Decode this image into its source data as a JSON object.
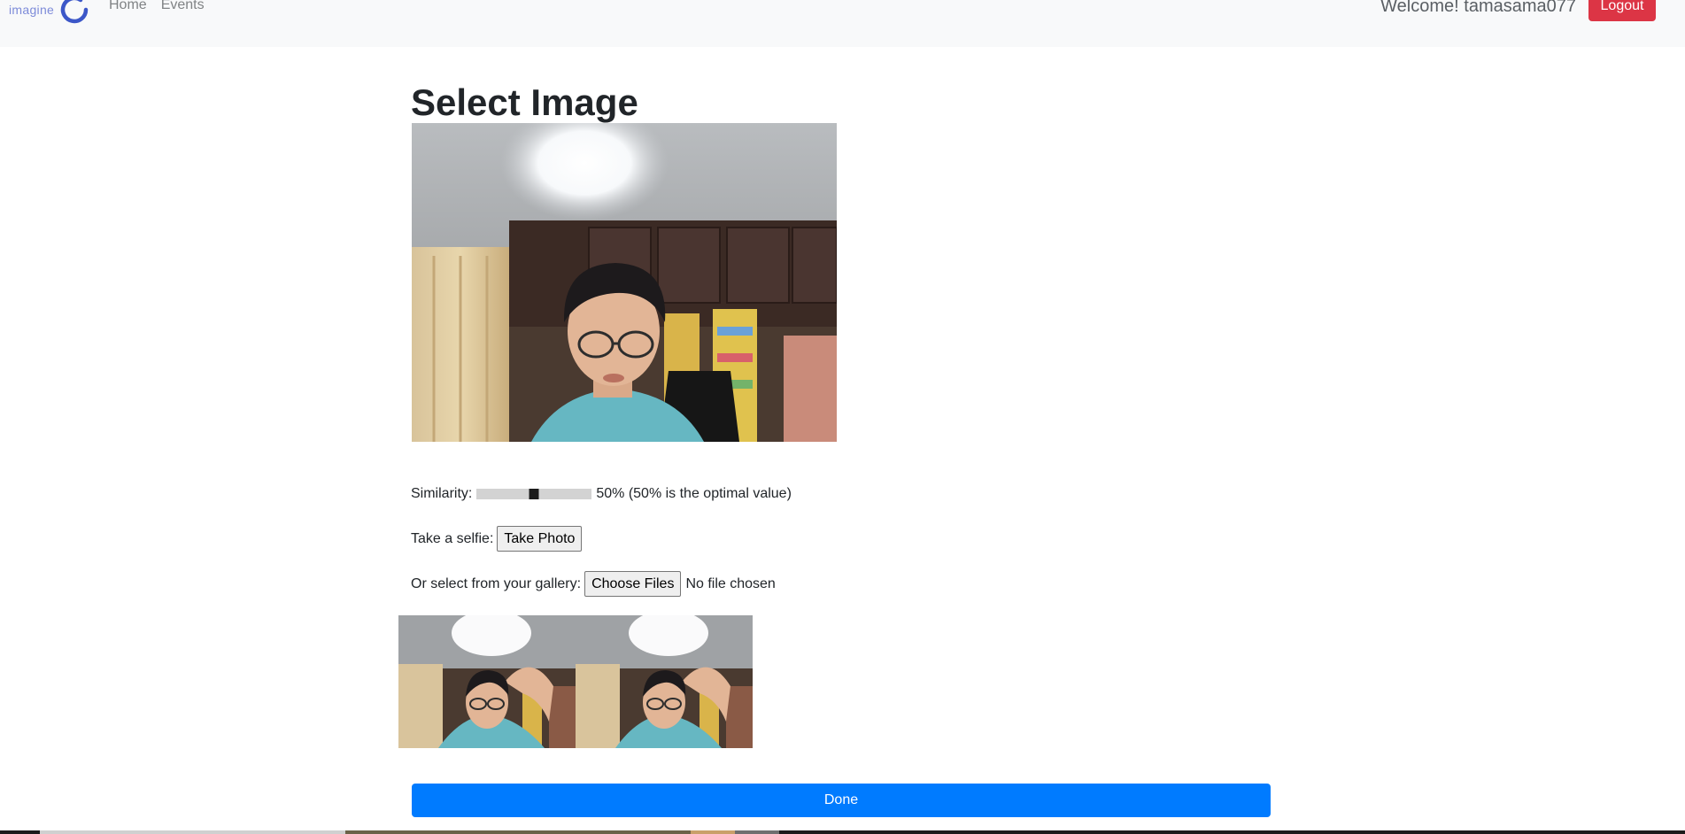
{
  "navbar": {
    "brand_text": "imagine",
    "links": [
      "Home",
      "Events"
    ],
    "welcome": "Welcome! tamasama077",
    "logout_label": "Logout"
  },
  "main": {
    "title": "Select Image",
    "similarity": {
      "label": "Similarity:",
      "value": 50,
      "value_text": "50% (50% is the optimal value)"
    },
    "selfie": {
      "label": "Take a selfie:",
      "button": "Take Photo"
    },
    "gallery": {
      "label": "Or select from your gallery:",
      "button": "Choose Files",
      "status": "No file chosen"
    },
    "thumbnail_count": 2,
    "done_label": "Done"
  },
  "colors": {
    "navbar_bg": "#f8f9fa",
    "logout": "#dc3545",
    "done": "#007bff",
    "brand_logo": "#3c57c8"
  }
}
